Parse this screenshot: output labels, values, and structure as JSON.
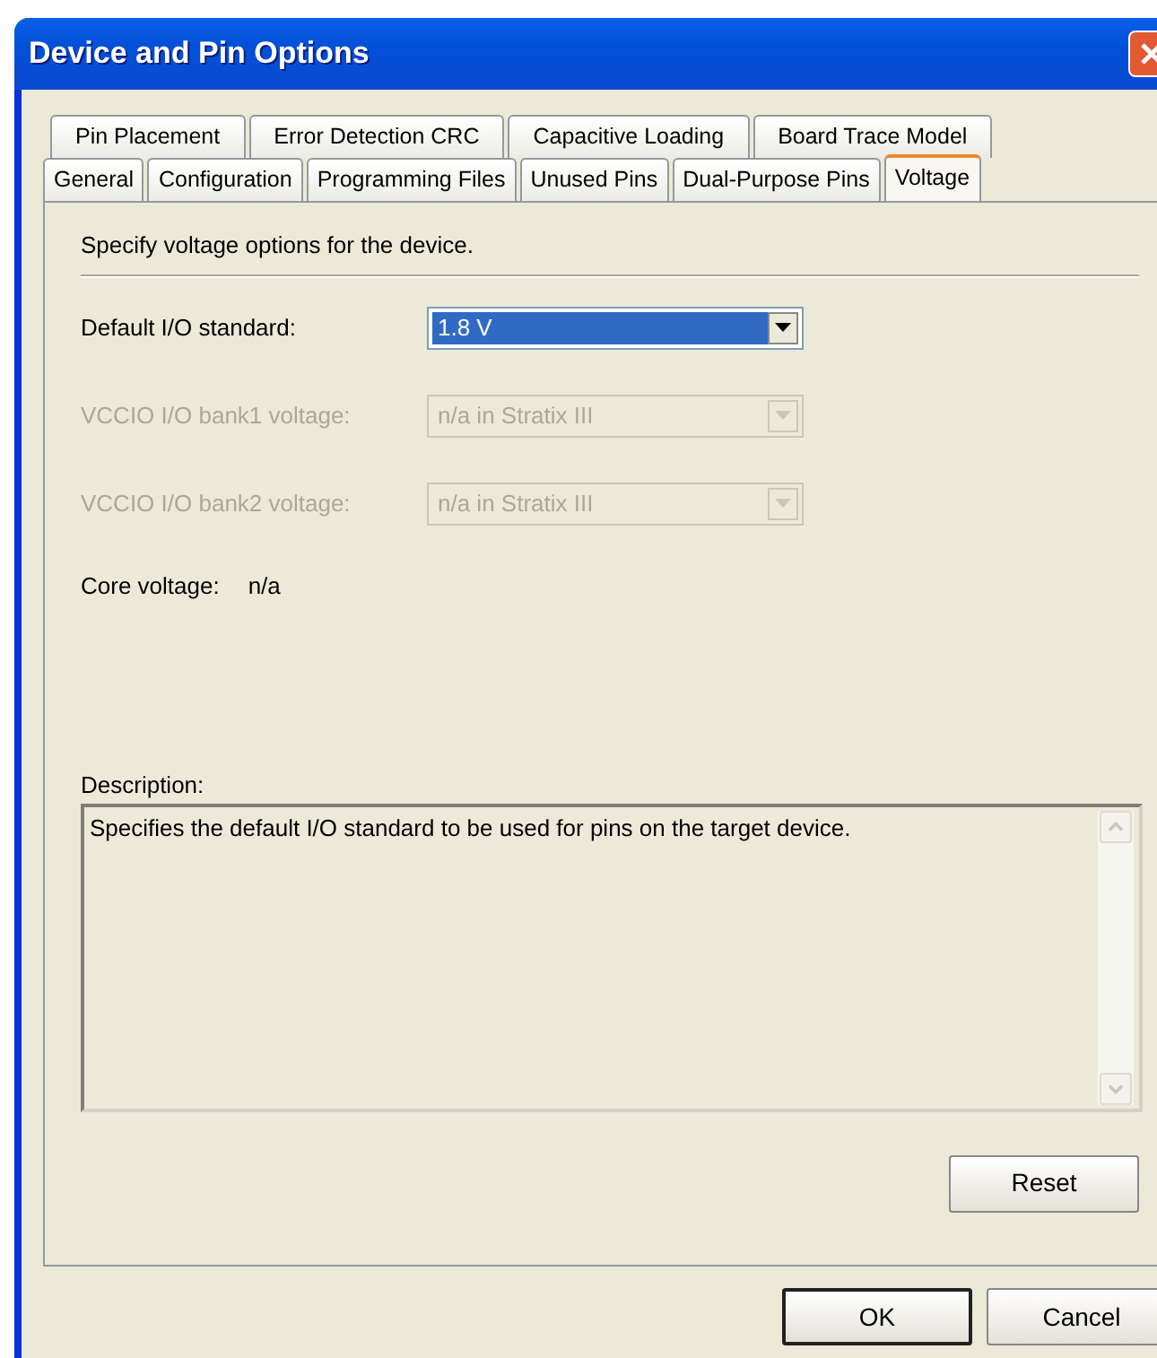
{
  "window": {
    "title": "Device and Pin Options"
  },
  "tab_rows": [
    [
      {
        "label": "Pin Placement",
        "selected": false
      },
      {
        "label": "Error Detection CRC",
        "selected": false
      },
      {
        "label": "Capacitive Loading",
        "selected": false
      },
      {
        "label": "Board Trace Model",
        "selected": false
      }
    ],
    [
      {
        "label": "General",
        "selected": false
      },
      {
        "label": "Configuration",
        "selected": false
      },
      {
        "label": "Programming Files",
        "selected": false
      },
      {
        "label": "Unused Pins",
        "selected": false
      },
      {
        "label": "Dual-Purpose Pins",
        "selected": false
      },
      {
        "label": "Voltage",
        "selected": true
      }
    ]
  ],
  "intro": "Specify voltage options for the device.",
  "fields": [
    {
      "label": "Default I/O standard:",
      "value": "1.8 V",
      "disabled": false,
      "focused": true
    },
    {
      "label": "VCCIO I/O bank1 voltage:",
      "value": "n/a in Stratix III",
      "disabled": true,
      "focused": false
    },
    {
      "label": "VCCIO I/O bank2 voltage:",
      "value": "n/a in Stratix III",
      "disabled": true,
      "focused": false
    }
  ],
  "core_voltage": {
    "label": "Core voltage:",
    "value": "n/a"
  },
  "description": {
    "label": "Description:",
    "text": "Specifies the default I/O standard to be used for pins on the target device."
  },
  "reset_button": "Reset",
  "buttons": [
    {
      "label": "OK",
      "default": true
    },
    {
      "label": "Cancel",
      "default": false
    }
  ]
}
